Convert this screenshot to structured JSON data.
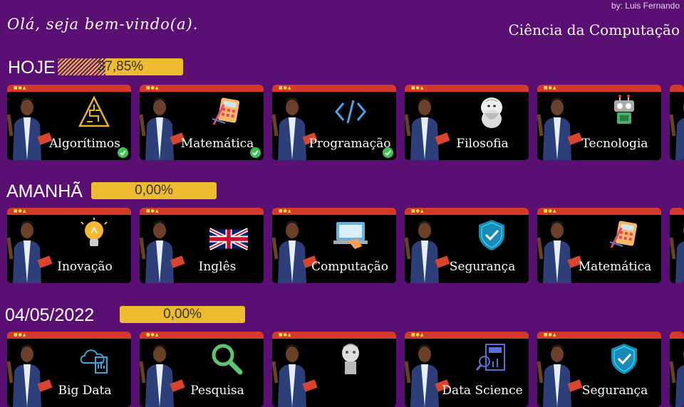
{
  "credit": "by: Luis Fernando",
  "greeting": "Olá, seja bem-vindo(a).",
  "course": "Ciência da Computação",
  "sections": [
    {
      "label": "HOJE",
      "progress_text": "37,85%",
      "progress_value": 0.3785,
      "cards": [
        {
          "label": "Algorítimos",
          "icon": "maze-pyramid-icon",
          "done": true
        },
        {
          "label": "Matemática",
          "icon": "calculator-icon",
          "done": true
        },
        {
          "label": "Programação",
          "icon": "code-brackets-icon",
          "done": true
        },
        {
          "label": "Filosofia",
          "icon": "philosopher-bust-icon",
          "done": false
        },
        {
          "label": "Tecnologia",
          "icon": "robot-icon",
          "done": false
        }
      ]
    },
    {
      "label": "AMANHÃ",
      "progress_text": "0,00%",
      "progress_value": 0,
      "cards": [
        {
          "label": "Inovação",
          "icon": "lightbulb-icon",
          "done": false
        },
        {
          "label": "Inglês",
          "icon": "uk-flag-icon",
          "done": false
        },
        {
          "label": "Computação",
          "icon": "laptop-icon",
          "done": false
        },
        {
          "label": "Segurança",
          "icon": "shield-check-icon",
          "done": false
        },
        {
          "label": "Matemática",
          "icon": "calculator-icon",
          "done": false
        }
      ]
    },
    {
      "label": "04/05/2022",
      "progress_text": "0,00%",
      "progress_value": 0,
      "cards": [
        {
          "label": "Big Data",
          "icon": "cloud-data-icon",
          "done": false
        },
        {
          "label": "Pesquisa",
          "icon": "magnifier-icon",
          "done": false
        },
        {
          "label": "",
          "icon": "robot-head-icon",
          "done": false
        },
        {
          "label": "Data Science",
          "icon": "data-report-icon",
          "done": false
        },
        {
          "label": "Segurança",
          "icon": "shield-check-icon",
          "done": false
        }
      ]
    }
  ]
}
